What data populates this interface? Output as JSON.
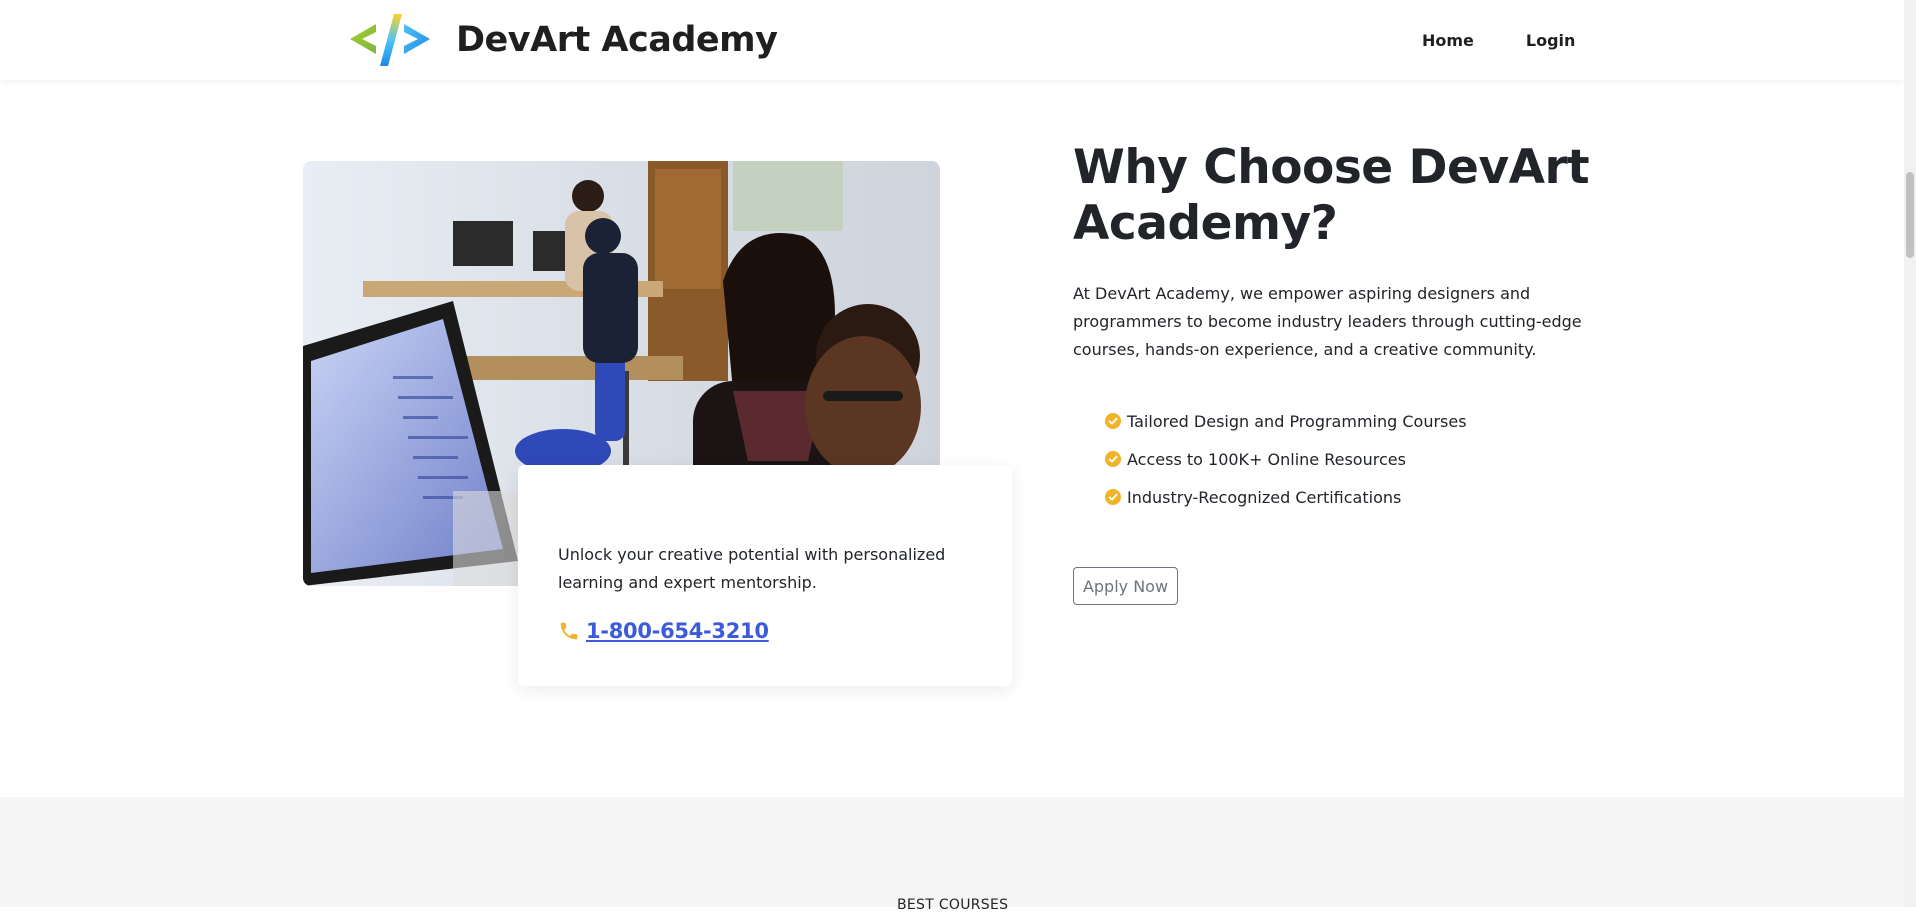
{
  "header": {
    "brand": "DevArt Academy",
    "nav": {
      "home": "Home",
      "login": "Login"
    }
  },
  "about": {
    "image_icon": "students-at-computer-photo",
    "card": {
      "text": "Unlock your creative potential with personalized learning and expert mentorship.",
      "phone": " 1-800-654-3210",
      "phone_icon": "phone-icon"
    },
    "title": "Why Choose DevArt Academy?",
    "description": "At DevArt Academy, we empower aspiring designers and programmers to become industry leaders through cutting-edge courses, hands-on experience, and a creative community.",
    "features": [
      "Tailored Design and Programming Courses",
      "Access to 100K+ Online Resources",
      "Industry-Recognized Certifications"
    ],
    "apply_label": "Apply Now"
  },
  "courses": {
    "kicker": "BEST COURSES"
  },
  "colors": {
    "accent": "#f0b429",
    "link": "#3b5bdb",
    "text": "#212529",
    "section_bg": "#f5f5f5"
  }
}
